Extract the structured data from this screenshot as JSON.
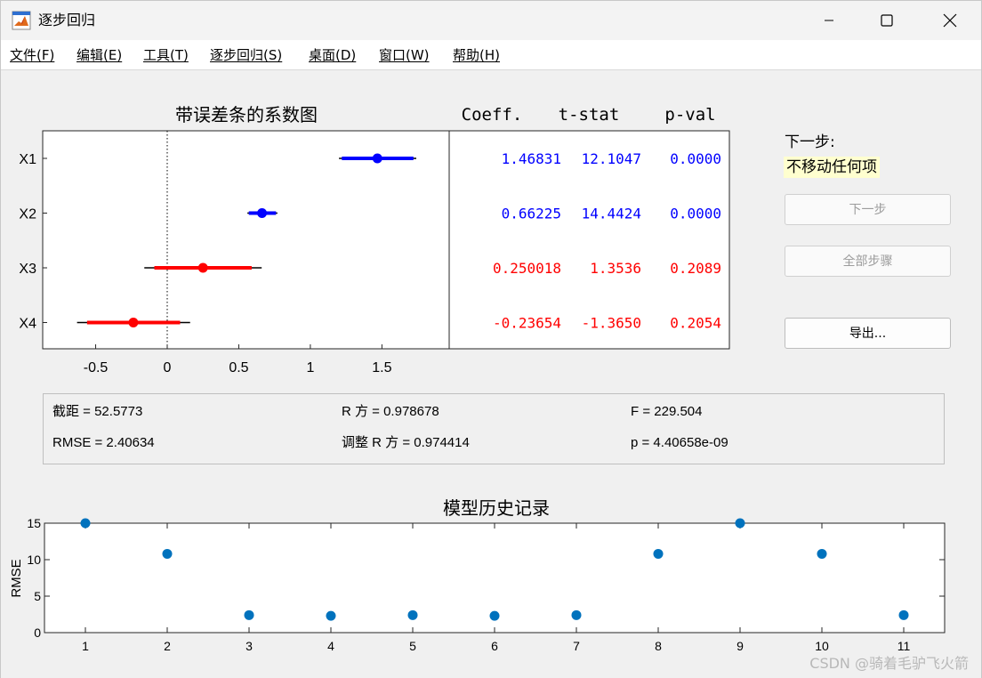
{
  "window": {
    "title": "逐步回归",
    "minimize_icon": "minimize-icon",
    "maximize_icon": "maximize-icon",
    "close_icon": "close-icon",
    "app_icon": "matlab-logo-icon"
  },
  "menu": [
    {
      "label": "文件(F)"
    },
    {
      "label": "编辑(E)"
    },
    {
      "label": "工具(T)"
    },
    {
      "label": "逐步回归(S)"
    },
    {
      "label": "桌面(D)"
    },
    {
      "label": "窗口(W)"
    },
    {
      "label": "帮助(H)"
    }
  ],
  "coef_plot": {
    "title": "带误差条的系数图",
    "xlim": [
      -0.87,
      1.97
    ],
    "x_ticks": [
      "-0.5",
      "0",
      "0.5",
      "1",
      "1.5"
    ],
    "x_tick_values": [
      -0.5,
      0,
      0.5,
      1,
      1.5
    ],
    "rows": [
      {
        "label": "X1",
        "coef": 1.46831,
        "inner": [
          1.22,
          1.72
        ],
        "outer": [
          1.2,
          1.74
        ],
        "color": "#0000ff"
      },
      {
        "label": "X2",
        "coef": 0.66225,
        "inner": [
          0.57,
          0.76
        ],
        "outer": [
          0.56,
          0.77
        ],
        "color": "#0000ff"
      },
      {
        "label": "X3",
        "coef": 0.250018,
        "inner": [
          -0.09,
          0.59
        ],
        "outer": [
          -0.16,
          0.66
        ],
        "color": "#ff0000"
      },
      {
        "label": "X4",
        "coef": -0.23654,
        "inner": [
          -0.56,
          0.09
        ],
        "outer": [
          -0.63,
          0.16
        ],
        "color": "#ff0000"
      }
    ]
  },
  "coef_table": {
    "headers": [
      "Coeff.",
      "t-stat",
      "p-val"
    ],
    "rows": [
      {
        "coeff": "1.46831",
        "tstat": "12.1047",
        "pval": "0.0000",
        "color": "#0000ff"
      },
      {
        "coeff": "0.66225",
        "tstat": "14.4424",
        "pval": "0.0000",
        "color": "#0000ff"
      },
      {
        "coeff": "0.250018",
        "tstat": "1.3536",
        "pval": "0.2089",
        "color": "#ff0000"
      },
      {
        "coeff": "-0.23654",
        "tstat": "-1.3650",
        "pval": "0.2054",
        "color": "#ff0000"
      }
    ]
  },
  "side_panel": {
    "next_step_label": "下一步:",
    "next_step_value": "不移动任何项",
    "next_button": "下一步",
    "all_steps_button": "全部步骤",
    "export_button": "导出..."
  },
  "stats": {
    "intercept": "截距 = 52.5773",
    "rsq": "R 方 = 0.978678",
    "f": "F = 229.504",
    "rmse": "RMSE = 2.40634",
    "adj_rsq": "调整 R 方 = 0.974414",
    "p": "p = 4.40658e-09"
  },
  "chart_data": {
    "type": "scatter",
    "title": "模型历史记录",
    "xlabel": "",
    "ylabel": "RMSE",
    "x": [
      1,
      2,
      3,
      4,
      5,
      6,
      7,
      8,
      9,
      10,
      11
    ],
    "y": [
      15,
      10.8,
      2.4,
      2.3,
      2.4,
      2.3,
      2.4,
      10.8,
      15,
      10.8,
      2.4
    ],
    "xlim": [
      0.5,
      11.5
    ],
    "ylim": [
      0,
      15
    ],
    "x_ticks": [
      "1",
      "2",
      "3",
      "4",
      "5",
      "6",
      "7",
      "8",
      "9",
      "10",
      "11"
    ],
    "y_ticks": [
      "0",
      "5",
      "10",
      "15"
    ],
    "grid": false,
    "color": "#0072bd"
  },
  "watermark": "CSDN @骑着毛驴飞火箭"
}
